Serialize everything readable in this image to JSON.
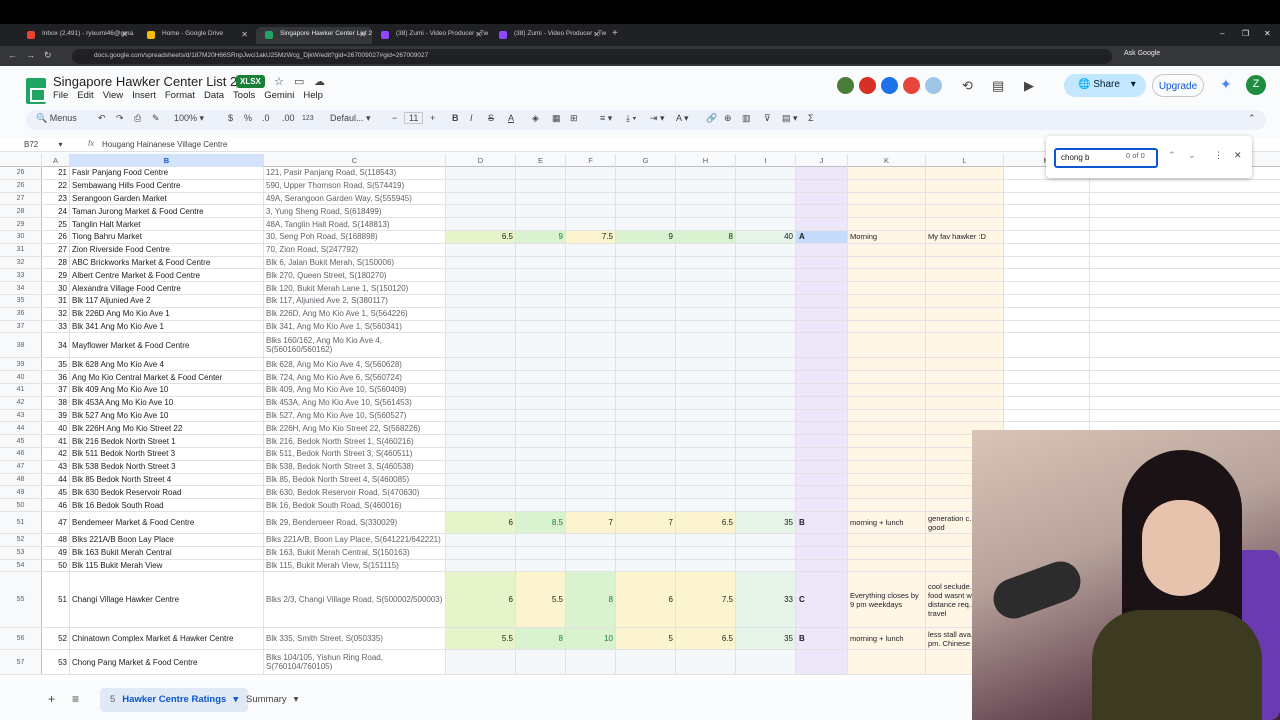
{
  "browser": {
    "tabs": [
      {
        "label": "Inbox (2,491) - ryixumi46@gma...",
        "color": "#ea4335"
      },
      {
        "label": "Home - Google Drive",
        "color": "#fbbc04"
      },
      {
        "label": "Singapore Hawker Center List 2...",
        "color": "#1fa463"
      },
      {
        "label": "(38) Zumi - Video Producer - Tw...",
        "color": "#9146ff"
      },
      {
        "label": "(38) Zumi - Video Producer - Tw...",
        "color": "#9146ff"
      }
    ],
    "url": "docs.google.com/spreadsheets/d/187M20H66SRnpJwci1akU25MzWcg_DjkW/edit?gid=267009027#gid=267009027",
    "ask_google": "Ask Google"
  },
  "doc": {
    "title": "Singapore Hawker Center List 2026",
    "badge": "XLSX",
    "menus": [
      "File",
      "Edit",
      "View",
      "Insert",
      "Format",
      "Data",
      "Tools",
      "Gemini",
      "Help"
    ],
    "share": "Share",
    "upgrade": "Upgrade",
    "user_initial": "Z"
  },
  "toolbar": {
    "menus": "Menus",
    "zoom": "100%",
    "currency": "$",
    "percent": "%",
    "dec_less": ".0",
    "dec_more": ".00",
    "numfmt": "123",
    "font": "Defaul...",
    "font_size": "11"
  },
  "formula_bar": {
    "cell_ref": "B72",
    "fx": "fx",
    "value": "Hougang Hainanese Village Centre"
  },
  "columns": [
    "A",
    "B",
    "C",
    "D",
    "E",
    "F",
    "G",
    "H",
    "I",
    "J",
    "K",
    "L",
    "M"
  ],
  "selected_column": "B",
  "find": {
    "query": "chong b",
    "count": "0 of 0"
  },
  "rows": [
    {
      "rn": "26",
      "idx": "21",
      "name": "Fasir Panjang Food Centre",
      "addr": "121, Pasir Panjang Road, S(118543)"
    },
    {
      "rn": "26",
      "idx": "22",
      "name": "Sembawang Hills Food Centre",
      "addr": "590, Upper Thomson Road, S(574419)"
    },
    {
      "rn": "27",
      "idx": "23",
      "name": "Serangoon Garden Market",
      "addr": "49A, Serangoon Garden Way, S(555945)"
    },
    {
      "rn": "28",
      "idx": "24",
      "name": "Taman Jurong Market & Food Centre",
      "addr": "3, Yung Sheng Road, S(618499)"
    },
    {
      "rn": "29",
      "idx": "25",
      "name": "Tanglin Halt Market",
      "addr": "48A, Tanglin Halt Road, S(148813)"
    },
    {
      "rn": "30",
      "idx": "26",
      "name": "Tiong Bahru Market",
      "addr": "30, Seng Poh Road, S(168898)",
      "d": "6.5",
      "e": "9",
      "f": "7.5",
      "g": "9",
      "h": "8",
      "i": "40",
      "grade": "A",
      "time": "Morning",
      "note": "My fav hawker :D"
    },
    {
      "rn": "31",
      "idx": "27",
      "name": "Zion Riverside Food Centre",
      "addr": "70, Zion Road, S(247792)"
    },
    {
      "rn": "32",
      "idx": "28",
      "name": "ABC Brickworks Market & Food Centre",
      "addr": "Blk 6, Jalan Bukit Merah, S(150006)"
    },
    {
      "rn": "33",
      "idx": "29",
      "name": "Albert Centre Market & Food Centre",
      "addr": "Blk 270, Queen Street, S(180270)"
    },
    {
      "rn": "34",
      "idx": "30",
      "name": "Alexandra Village Food Centre",
      "addr": "Blk 120, Bukit Merah Lane 1, S(150120)"
    },
    {
      "rn": "35",
      "idx": "31",
      "name": "Blk 117 Aljunied Ave 2",
      "addr": "Blk 117, Aljunied Ave 2, S(380117)"
    },
    {
      "rn": "36",
      "idx": "32",
      "name": "Blk 226D Ang Mo Kio Ave 1",
      "addr": "Blk 226D, Ang Mo Kio Ave 1, S(564226)"
    },
    {
      "rn": "37",
      "idx": "33",
      "name": "Blk 341 Ang Mo Kio Ave 1",
      "addr": "Blk 341, Ang Mo Kio Ave 1, S(560341)"
    },
    {
      "rn": "38",
      "idx": "34",
      "name": "Mayflower Market & Food Centre",
      "addr": "Blks 160/162, Ang Mo Kio Ave 4, S(560160/560162)",
      "tall": 1
    },
    {
      "rn": "39",
      "idx": "35",
      "name": "Blk 628 Ang Mo Kio Ave 4",
      "addr": "Blk 628, Ang Mo Kio Ave 4, S(560628)"
    },
    {
      "rn": "40",
      "idx": "36",
      "name": "Ang Mo Kio Central Market & Food Center",
      "addr": "Blk 724, Ang Mo Kio Ave 6, S(560724)"
    },
    {
      "rn": "41",
      "idx": "37",
      "name": "Blk 409 Ang Mo Kio Ave 10",
      "addr": "Blk 409, Ang Mo Kio Ave 10, S(560409)"
    },
    {
      "rn": "42",
      "idx": "38",
      "name": "Blk 453A Ang Mo Kio Ave 10",
      "addr": "Blk 453A, Ang Mo Kio Ave 10, S(561453)"
    },
    {
      "rn": "43",
      "idx": "39",
      "name": "Blk 527 Ang Mo Kio Ave 10",
      "addr": "Blk 527, Ang Mo Kio Ave 10, S(560527)"
    },
    {
      "rn": "44",
      "idx": "40",
      "name": "Blk 226H Ang Mo Kio Street 22",
      "addr": "Blk 226H, Ang Mo Kio Street 22, S(568226)"
    },
    {
      "rn": "45",
      "idx": "41",
      "name": "Blk 216 Bedok North Street 1",
      "addr": "Blk 216, Bedok North Street 1, S(460216)"
    },
    {
      "rn": "46",
      "idx": "42",
      "name": "Blk 511 Bedok North Street 3",
      "addr": "Blk 511, Bedok North Street 3, S(460511)"
    },
    {
      "rn": "47",
      "idx": "43",
      "name": "Blk 538 Bedok North Street 3",
      "addr": "Blk 538, Bedok North Street 3, S(460538)"
    },
    {
      "rn": "48",
      "idx": "44",
      "name": "Blk 85 Bedok North Street 4",
      "addr": "Blk 85, Bedok North Street 4, S(460085)"
    },
    {
      "rn": "49",
      "idx": "45",
      "name": "Blk 630 Bedok Reservoir Road",
      "addr": "Blk 630, Bedok Reservoir Road, S(470630)"
    },
    {
      "rn": "50",
      "idx": "46",
      "name": "Blk 16 Bedok South Road",
      "addr": "Blk 16, Bedok South Road, S(460016)"
    },
    {
      "rn": "51",
      "idx": "47",
      "name": "Bendemeer Market & Food Centre",
      "addr": "Blk 29, Bendemeer Road, S(330029)",
      "d": "6",
      "e": "8.5",
      "f": "7",
      "g": "7",
      "h": "6.5",
      "i": "35",
      "grade": "B",
      "time": "morning + lunch",
      "note": "generation c... was good",
      "tall": 2
    },
    {
      "rn": "52",
      "idx": "48",
      "name": "Blks 221A/B Boon Lay Place",
      "addr": "Blks 221A/B, Boon Lay Place, S(641221/642221)"
    },
    {
      "rn": "53",
      "idx": "49",
      "name": "Blk 163 Bukit Merah Central",
      "addr": "Blk 163, Bukit Merah Central, S(150163)"
    },
    {
      "rn": "54",
      "idx": "50",
      "name": "Blk 115 Bukit Merah View",
      "addr": "Blk 115, Bukit Merah View, S(151115)"
    },
    {
      "rn": "55",
      "idx": "51",
      "name": "Changi Village Hawker Centre",
      "addr": "Blks 2/3, Changi Village Road, S(500002/500003)",
      "d": "6",
      "e": "5.5",
      "f": "8",
      "g": "6",
      "h": "7.5",
      "i": "33",
      "grade": "C",
      "time": "Everything closes by 9 pm weekdays",
      "note": "cool seclude... but the food wasnt worth distance req... to travel",
      "tall": 3
    },
    {
      "rn": "56",
      "idx": "52",
      "name": "Chinatown Complex Market & Hawker Centre",
      "addr": "Blk 335, Smith Street, S(050335)",
      "d": "5.5",
      "e": "8",
      "f": "10",
      "g": "5",
      "h": "6.5",
      "i": "35",
      "grade": "B",
      "time": "morning + lunch",
      "note": "less stall ava... after 2 pm. Chinese foo...",
      "tall": 2
    },
    {
      "rn": "57",
      "idx": "53",
      "name": "Chong Pang Market & Food Centre",
      "addr": "Blks 104/105, Yishun Ring Road, S(760104/760105)",
      "tall": 1
    }
  ],
  "sheets": [
    {
      "num": "5",
      "label": "Hawker Centre Ratings",
      "active": true
    },
    {
      "label": "Summary",
      "active": false
    }
  ]
}
